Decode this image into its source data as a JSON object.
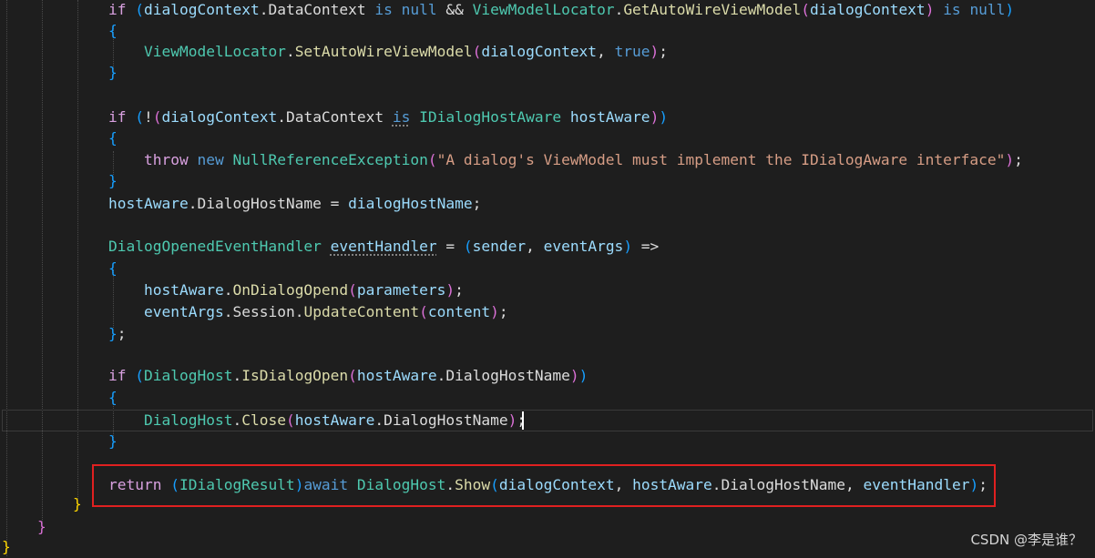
{
  "editor": {
    "lines": [
      {
        "tokens": [
          {
            "t": "if ",
            "c": "ctl"
          },
          {
            "t": "(",
            "c": "b3"
          },
          {
            "t": "dialogContext",
            "c": "vr"
          },
          {
            "t": ".",
            "c": "pl"
          },
          {
            "t": "DataContext",
            "c": "pl"
          },
          {
            "t": " ",
            "c": "pl"
          },
          {
            "t": "is",
            "c": "kw"
          },
          {
            "t": " ",
            "c": "pl"
          },
          {
            "t": "null",
            "c": "kw"
          },
          {
            "t": " && ",
            "c": "pl"
          },
          {
            "t": "ViewModelLocator",
            "c": "ty"
          },
          {
            "t": ".",
            "c": "pl"
          },
          {
            "t": "GetAutoWireViewModel",
            "c": "fn"
          },
          {
            "t": "(",
            "c": "b2"
          },
          {
            "t": "dialogContext",
            "c": "vr"
          },
          {
            "t": ")",
            "c": "b2"
          },
          {
            "t": " ",
            "c": "pl"
          },
          {
            "t": "is",
            "c": "kw"
          },
          {
            "t": " ",
            "c": "pl"
          },
          {
            "t": "null",
            "c": "kw"
          },
          {
            "t": ")",
            "c": "b3"
          }
        ]
      },
      {
        "tokens": [
          {
            "t": "{",
            "c": "b3"
          }
        ]
      },
      {
        "tokens": [
          {
            "t": "ViewModelLocator",
            "c": "ty"
          },
          {
            "t": ".",
            "c": "pl"
          },
          {
            "t": "SetAutoWireViewModel",
            "c": "fn"
          },
          {
            "t": "(",
            "c": "b2"
          },
          {
            "t": "dialogContext",
            "c": "vr"
          },
          {
            "t": ", ",
            "c": "pl"
          },
          {
            "t": "true",
            "c": "kw"
          },
          {
            "t": ")",
            "c": "b2"
          },
          {
            "t": ";",
            "c": "pl"
          }
        ]
      },
      {
        "tokens": [
          {
            "t": "}",
            "c": "b3"
          }
        ]
      },
      {
        "tokens": []
      },
      {
        "tokens": [
          {
            "t": "if ",
            "c": "ctl"
          },
          {
            "t": "(",
            "c": "b3"
          },
          {
            "t": "!",
            "c": "pl"
          },
          {
            "t": "(",
            "c": "b2"
          },
          {
            "t": "dialogContext",
            "c": "vr"
          },
          {
            "t": ".",
            "c": "pl"
          },
          {
            "t": "DataContext",
            "c": "pl"
          },
          {
            "t": " ",
            "c": "pl"
          },
          {
            "t": "is",
            "c": "kw sq"
          },
          {
            "t": " ",
            "c": "pl"
          },
          {
            "t": "IDialogHostAware",
            "c": "ty"
          },
          {
            "t": " ",
            "c": "pl"
          },
          {
            "t": "hostAware",
            "c": "vr"
          },
          {
            "t": ")",
            "c": "b2"
          },
          {
            "t": ")",
            "c": "b3"
          }
        ]
      },
      {
        "tokens": [
          {
            "t": "{",
            "c": "b3"
          }
        ]
      },
      {
        "tokens": [
          {
            "t": "throw ",
            "c": "ctl"
          },
          {
            "t": "new ",
            "c": "kw"
          },
          {
            "t": "NullReferenceException",
            "c": "ty"
          },
          {
            "t": "(",
            "c": "b2"
          },
          {
            "t": "\"A dialog's ViewModel must implement the IDialogAware interface\"",
            "c": "st"
          },
          {
            "t": ")",
            "c": "b2"
          },
          {
            "t": ";",
            "c": "pl"
          }
        ]
      },
      {
        "tokens": [
          {
            "t": "}",
            "c": "b3"
          }
        ]
      },
      {
        "tokens": [
          {
            "t": "hostAware",
            "c": "vr"
          },
          {
            "t": ".",
            "c": "pl"
          },
          {
            "t": "DialogHostName",
            "c": "pl"
          },
          {
            "t": " = ",
            "c": "pl"
          },
          {
            "t": "dialogHostName",
            "c": "vr"
          },
          {
            "t": ";",
            "c": "pl"
          }
        ]
      },
      {
        "tokens": []
      },
      {
        "tokens": [
          {
            "t": "DialogOpenedEventHandler",
            "c": "ty"
          },
          {
            "t": " ",
            "c": "pl"
          },
          {
            "t": "eventHandler",
            "c": "vr sq"
          },
          {
            "t": " = ",
            "c": "pl"
          },
          {
            "t": "(",
            "c": "b3"
          },
          {
            "t": "sender",
            "c": "vr"
          },
          {
            "t": ", ",
            "c": "pl"
          },
          {
            "t": "eventArgs",
            "c": "vr"
          },
          {
            "t": ")",
            "c": "b3"
          },
          {
            "t": " =>",
            "c": "pl"
          }
        ]
      },
      {
        "tokens": [
          {
            "t": "{",
            "c": "b3"
          }
        ]
      },
      {
        "tokens": [
          {
            "t": "hostAware",
            "c": "vr"
          },
          {
            "t": ".",
            "c": "pl"
          },
          {
            "t": "OnDialogOpend",
            "c": "fn"
          },
          {
            "t": "(",
            "c": "b2"
          },
          {
            "t": "parameters",
            "c": "vr"
          },
          {
            "t": ")",
            "c": "b2"
          },
          {
            "t": ";",
            "c": "pl"
          }
        ]
      },
      {
        "tokens": [
          {
            "t": "eventArgs",
            "c": "vr"
          },
          {
            "t": ".",
            "c": "pl"
          },
          {
            "t": "Session",
            "c": "pl"
          },
          {
            "t": ".",
            "c": "pl"
          },
          {
            "t": "UpdateContent",
            "c": "fn"
          },
          {
            "t": "(",
            "c": "b2"
          },
          {
            "t": "content",
            "c": "vr"
          },
          {
            "t": ")",
            "c": "b2"
          },
          {
            "t": ";",
            "c": "pl"
          }
        ]
      },
      {
        "tokens": [
          {
            "t": "}",
            "c": "b3"
          },
          {
            "t": ";",
            "c": "pl"
          }
        ]
      },
      {
        "tokens": []
      },
      {
        "tokens": [
          {
            "t": "if ",
            "c": "ctl"
          },
          {
            "t": "(",
            "c": "b3"
          },
          {
            "t": "DialogHost",
            "c": "ty"
          },
          {
            "t": ".",
            "c": "pl"
          },
          {
            "t": "IsDialogOpen",
            "c": "fn"
          },
          {
            "t": "(",
            "c": "b2"
          },
          {
            "t": "hostAware",
            "c": "vr"
          },
          {
            "t": ".",
            "c": "pl"
          },
          {
            "t": "DialogHostName",
            "c": "pl"
          },
          {
            "t": ")",
            "c": "b2"
          },
          {
            "t": ")",
            "c": "b3"
          }
        ]
      },
      {
        "tokens": [
          {
            "t": "{",
            "c": "b3"
          }
        ]
      },
      {
        "tokens": [
          {
            "t": "DialogHost",
            "c": "ty"
          },
          {
            "t": ".",
            "c": "pl"
          },
          {
            "t": "Close",
            "c": "fn"
          },
          {
            "t": "(",
            "c": "b2"
          },
          {
            "t": "hostAware",
            "c": "vr"
          },
          {
            "t": ".",
            "c": "pl"
          },
          {
            "t": "DialogHostName",
            "c": "pl"
          },
          {
            "t": ")",
            "c": "b2"
          },
          {
            "t": ";",
            "c": "pl"
          }
        ]
      },
      {
        "tokens": [
          {
            "t": "}",
            "c": "b3"
          }
        ]
      },
      {
        "tokens": []
      },
      {
        "tokens": [
          {
            "t": "return ",
            "c": "ret"
          },
          {
            "t": "(",
            "c": "b3"
          },
          {
            "t": "IDialogResult",
            "c": "ty"
          },
          {
            "t": ")",
            "c": "b3"
          },
          {
            "t": "await ",
            "c": "kw"
          },
          {
            "t": "DialogHost",
            "c": "ty"
          },
          {
            "t": ".",
            "c": "pl"
          },
          {
            "t": "Show",
            "c": "fn"
          },
          {
            "t": "(",
            "c": "b3"
          },
          {
            "t": "dialogContext",
            "c": "vr"
          },
          {
            "t": ", ",
            "c": "pl"
          },
          {
            "t": "hostAware",
            "c": "vr"
          },
          {
            "t": ".",
            "c": "pl"
          },
          {
            "t": "DialogHostName",
            "c": "pl"
          },
          {
            "t": ", ",
            "c": "pl"
          },
          {
            "t": "eventHandler",
            "c": "vr"
          },
          {
            "t": ")",
            "c": "b3"
          },
          {
            "t": ";",
            "c": "pl"
          }
        ]
      },
      {
        "tokens": [
          {
            "t": "}",
            "c": "b1"
          }
        ]
      },
      {
        "tokens": [
          {
            "t": "}",
            "c": "b2"
          }
        ]
      },
      {
        "tokens": [
          {
            "t": "}",
            "c": "b1"
          }
        ]
      }
    ]
  },
  "watermark": "CSDN @李是谁？"
}
